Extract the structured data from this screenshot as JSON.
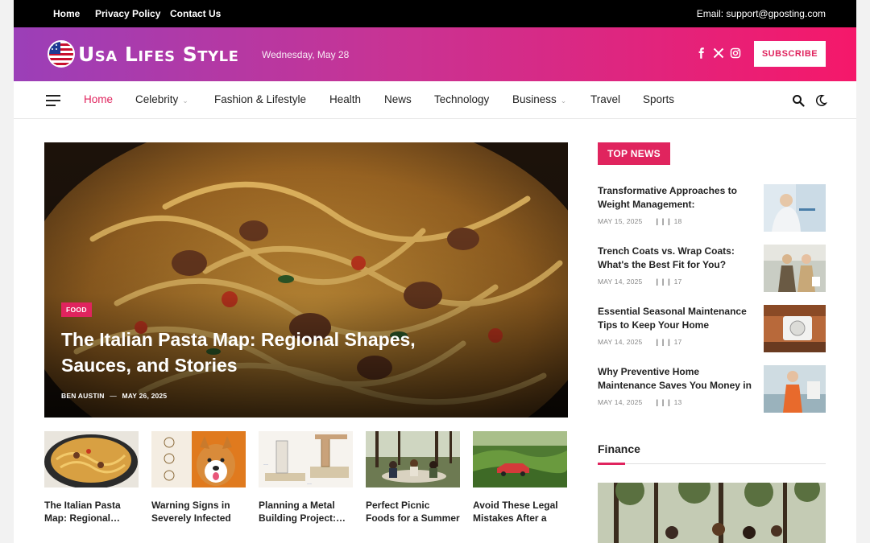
{
  "topbar": {
    "links": [
      "Home",
      "Privacy Policy",
      "Contact Us"
    ],
    "email": "Email: support@gposting.com"
  },
  "header": {
    "logo_text": "Usa Lifes Style",
    "date": "Wednesday, May 28",
    "subscribe": "SUBSCRIBE",
    "social_icons": [
      "facebook-icon",
      "x-icon",
      "instagram-icon"
    ],
    "gradient": [
      "#9b3fb8",
      "#f5186a"
    ]
  },
  "nav": {
    "items": [
      {
        "label": "Home",
        "active": true
      },
      {
        "label": "Celebrity",
        "dropdown": true
      },
      {
        "label": "Fashion & Lifestyle"
      },
      {
        "label": "Health"
      },
      {
        "label": "News"
      },
      {
        "label": "Technology"
      },
      {
        "label": "Business",
        "dropdown": true
      },
      {
        "label": "Travel"
      },
      {
        "label": "Sports"
      }
    ],
    "icons": [
      "menu-icon",
      "search-icon",
      "moon-icon"
    ]
  },
  "hero": {
    "category": "FOOD",
    "title": "The Italian Pasta Map: Regional Shapes, Sauces, and Stories",
    "author": "BEN AUSTIN",
    "separator": "—",
    "date": "MAY 26, 2025"
  },
  "cards": [
    {
      "title": "The Italian Pasta Map: Regional…"
    },
    {
      "title": "Warning Signs in Severely Infected D…"
    },
    {
      "title": "Planning a Metal Building Project:…"
    },
    {
      "title": "Perfect Picnic Foods for a Summer Day in…"
    },
    {
      "title": "Avoid These Legal Mistakes After a Ca…"
    }
  ],
  "sidebar": {
    "heading": "TOP NEWS",
    "items": [
      {
        "title": "Transformative Approaches to Weight Management: Technology…",
        "date": "MAY 15, 2025",
        "views": "18"
      },
      {
        "title": "Trench Coats vs. Wrap Coats: What's the Best Fit for You?",
        "date": "MAY 14, 2025",
        "views": "17"
      },
      {
        "title": "Essential Seasonal Maintenance Tips to Keep Your Home Running…",
        "date": "MAY 14, 2025",
        "views": "17"
      },
      {
        "title": "Why Preventive Home Maintenance Saves You Money in the Long Run",
        "date": "MAY 14, 2025",
        "views": "13"
      }
    ],
    "section": "Finance"
  },
  "colors": {
    "accent": "#e0245e",
    "topbar": "#000000"
  }
}
